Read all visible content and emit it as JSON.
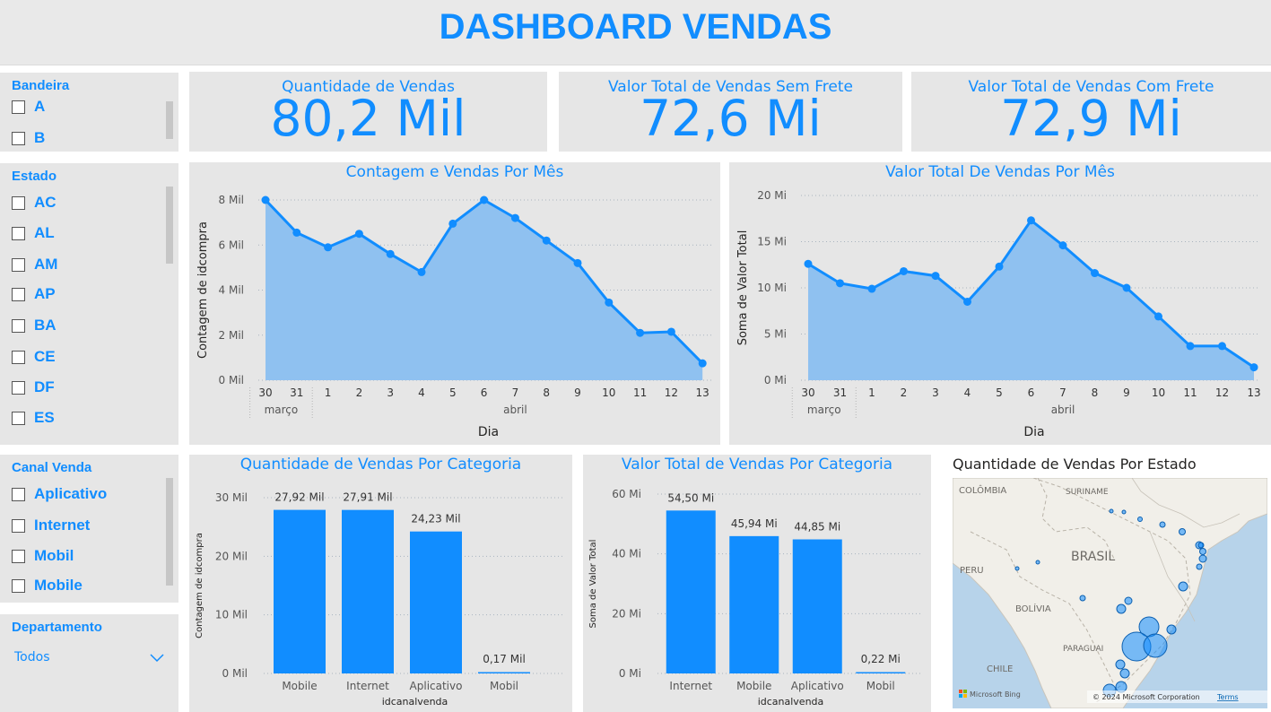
{
  "header": {
    "title": "DASHBOARD VENDAS"
  },
  "colors": {
    "accent": "#118dff",
    "area_fill": "#8fc1f0",
    "panel_bg": "#e6e6e6"
  },
  "slicers": {
    "bandeira": {
      "title": "Bandeira",
      "options": [
        "A",
        "B"
      ]
    },
    "estado": {
      "title": "Estado",
      "options": [
        "AC",
        "AL",
        "AM",
        "AP",
        "BA",
        "CE",
        "DF",
        "ES"
      ]
    },
    "canal": {
      "title": "Canal Venda",
      "options": [
        "Aplicativo",
        "Internet",
        "Mobil",
        "Mobile"
      ]
    },
    "departamento": {
      "title": "Departamento",
      "selected": "Todos"
    }
  },
  "kpis": [
    {
      "label": "Quantidade de Vendas",
      "value": "80,2 Mil"
    },
    {
      "label": "Valor Total de Vendas Sem Frete",
      "value": "72,6 Mi"
    },
    {
      "label": "Valor Total de Vendas Com Frete",
      "value": "72,9 Mi"
    }
  ],
  "chart_data": [
    {
      "type": "area",
      "title": "Contagem e Vendas Por Mês",
      "xlabel": "Dia",
      "ylabel": "Contagem de idcompra",
      "x": [
        "30",
        "31",
        "1",
        "2",
        "3",
        "4",
        "5",
        "6",
        "7",
        "8",
        "9",
        "10",
        "11",
        "12",
        "13"
      ],
      "month_groups": [
        {
          "name": "março",
          "count": 2
        },
        {
          "name": "abril",
          "count": 13
        }
      ],
      "values": [
        8000,
        6550,
        5900,
        6500,
        5600,
        4800,
        6950,
        8000,
        7200,
        6200,
        5200,
        3450,
        2100,
        2150,
        750
      ],
      "ylim": [
        0,
        8000
      ],
      "yticks": [
        0,
        2000,
        4000,
        6000,
        8000
      ],
      "ytick_labels": [
        "0 Mil",
        "2 Mil",
        "4 Mil",
        "6 Mil",
        "8 Mil"
      ],
      "grid": true
    },
    {
      "type": "area",
      "title": "Valor Total De Vendas Por Mês",
      "xlabel": "Dia",
      "ylabel": "Soma de Valor Total",
      "x": [
        "30",
        "31",
        "1",
        "2",
        "3",
        "4",
        "5",
        "6",
        "7",
        "8",
        "9",
        "10",
        "11",
        "12",
        "13"
      ],
      "month_groups": [
        {
          "name": "março",
          "count": 2
        },
        {
          "name": "abril",
          "count": 13
        }
      ],
      "values": [
        12.6,
        10.5,
        9.9,
        11.8,
        11.3,
        8.5,
        12.3,
        17.3,
        14.6,
        11.6,
        10.0,
        6.9,
        3.7,
        3.7,
        1.4
      ],
      "ylim": [
        0,
        20
      ],
      "yticks": [
        0,
        5,
        10,
        15,
        20
      ],
      "ytick_labels": [
        "0 Mi",
        "5 Mi",
        "10 Mi",
        "15 Mi",
        "20 Mi"
      ],
      "grid": true
    },
    {
      "type": "bar",
      "title": "Quantidade de Vendas Por Categoria",
      "xlabel": "idcanalvenda",
      "ylabel": "Contagem de idcompra",
      "categories": [
        "Mobile",
        "Internet",
        "Aplicativo",
        "Mobil"
      ],
      "values": [
        27920,
        27910,
        24230,
        170
      ],
      "data_labels": [
        "27,92 Mil",
        "27,91 Mil",
        "24,23 Mil",
        "0,17 Mil"
      ],
      "ylim": [
        0,
        30000
      ],
      "yticks": [
        0,
        10000,
        20000,
        30000
      ],
      "ytick_labels": [
        "0 Mil",
        "10 Mil",
        "20 Mil",
        "30 Mil"
      ],
      "grid": true
    },
    {
      "type": "bar",
      "title": "Valor Total de Vendas Por Categoria",
      "xlabel": "idcanalvenda",
      "ylabel": "Soma de Valor Total",
      "categories": [
        "Internet",
        "Mobile",
        "Aplicativo",
        "Mobil"
      ],
      "values": [
        54.5,
        45.94,
        44.85,
        0.22
      ],
      "data_labels": [
        "54,50 Mi",
        "45,94 Mi",
        "44,85 Mi",
        "0,22 Mi"
      ],
      "ylim": [
        0,
        60
      ],
      "yticks": [
        0,
        20,
        40,
        60
      ],
      "ytick_labels": [
        "0 Mi",
        "20 Mi",
        "40 Mi",
        "60 Mi"
      ],
      "grid": true
    }
  ],
  "map": {
    "title": "Quantidade de Vendas Por Estado",
    "labels": {
      "colombia": "COLÔMBIA",
      "suriname": "SURINAME",
      "brasil": "BRASIL",
      "peru": "PERU",
      "bolivia": "BOLÍVIA",
      "paraguai": "PARAGUAI",
      "chile": "CHILE"
    },
    "attribution": "© 2024 Microsoft Corporation",
    "terms": "Terms",
    "logo_text": "Microsoft Bing"
  }
}
